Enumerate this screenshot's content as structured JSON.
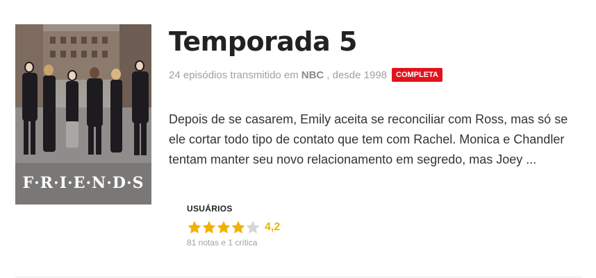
{
  "poster": {
    "logo_text": "F·R·I·E·N·D·S",
    "logo_dot_colors": [
      "#e53935",
      "#f9a825",
      "#1e88e5",
      "#e53935",
      "#f9a825",
      "#1e88e5"
    ]
  },
  "title": "Temporada 5",
  "meta": {
    "episodes_text": "24 episódios transmitido em",
    "network": "NBC",
    "since_text": ", desde 1998",
    "status_badge": "Completa"
  },
  "synopsis": "Depois de se casarem, Emily aceita se reconciliar com Ross, mas só se ele cortar todo tipo de contato que tem com Rachel. Monica e Chandler tentam manter seu novo relacionamento em segredo, mas Joey ...",
  "rating": {
    "label": "Usuários",
    "value": "4,2",
    "stars_filled": 4,
    "stars_total": 5,
    "count_text": "81 notas e 1 crítica"
  },
  "colors": {
    "accent_red": "#e0141d",
    "star_yellow": "#f2b100",
    "star_empty": "#d6d6d6"
  }
}
